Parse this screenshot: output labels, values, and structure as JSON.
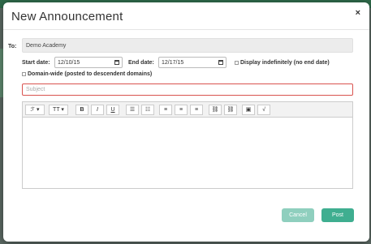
{
  "modal": {
    "title": "New Announcement",
    "close_glyph": "×"
  },
  "to": {
    "label": "To:",
    "value": "Demo Academy"
  },
  "dates": {
    "start_label": "Start date:",
    "start_value": "12/10/15",
    "end_label": "End date:",
    "end_value": "12/17/15",
    "indefinite_label": "Display indefinitely (no end date)",
    "indefinite_checked": false
  },
  "domain_wide": {
    "label": "Domain-wide (posted to descendent domains)",
    "checked": false
  },
  "subject": {
    "placeholder": "Subject",
    "value": ""
  },
  "toolbar": {
    "font": "ℱ ▾",
    "size": "TT ▾",
    "bold": "B",
    "italic": "I",
    "underline": "U",
    "bullets": "☰",
    "numbered": "☷",
    "align_left": "≡",
    "align_center": "≡",
    "align_right": "≡",
    "link": "⛓",
    "unlink": "⛓",
    "image": "▣",
    "equation": "√"
  },
  "buttons": {
    "cancel": "Cancel",
    "post": "Post"
  },
  "colors": {
    "accent": "#3fae90",
    "accent_disabled": "#8fcfbe",
    "error_border": "#d9534f"
  }
}
